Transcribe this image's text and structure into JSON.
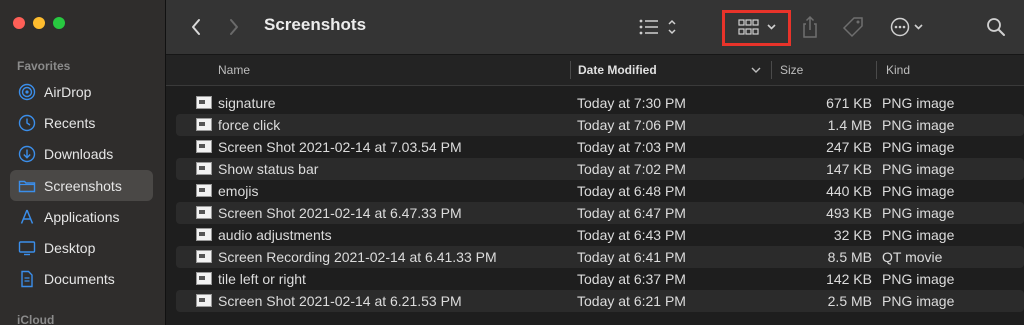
{
  "window": {
    "title": "Screenshots"
  },
  "sidebar": {
    "favorites_label": "Favorites",
    "icloud_label": "iCloud",
    "items": [
      {
        "label": "AirDrop",
        "icon": "airdrop-icon"
      },
      {
        "label": "Recents",
        "icon": "clock-icon"
      },
      {
        "label": "Downloads",
        "icon": "download-icon"
      },
      {
        "label": "Screenshots",
        "icon": "folder-icon",
        "selected": true
      },
      {
        "label": "Applications",
        "icon": "applications-icon"
      },
      {
        "label": "Desktop",
        "icon": "desktop-icon"
      },
      {
        "label": "Documents",
        "icon": "document-icon"
      }
    ]
  },
  "toolbar": {
    "back": "back-icon",
    "forward": "forward-icon",
    "view_list": "list-view-icon",
    "view_gallery": "gallery-view-icon",
    "share": "share-icon",
    "tag": "tag-icon",
    "more": "more-icon",
    "search": "search-icon"
  },
  "columns": {
    "name": "Name",
    "date": "Date Modified",
    "size": "Size",
    "kind": "Kind"
  },
  "files": [
    {
      "name": "signature",
      "date": "Today at 7:30 PM",
      "size": "671 KB",
      "kind": "PNG image"
    },
    {
      "name": "force click",
      "date": "Today at 7:06 PM",
      "size": "1.4 MB",
      "kind": "PNG image"
    },
    {
      "name": "Screen Shot 2021-02-14 at 7.03.54 PM",
      "date": "Today at 7:03 PM",
      "size": "247 KB",
      "kind": "PNG image"
    },
    {
      "name": "Show status bar",
      "date": "Today at 7:02 PM",
      "size": "147 KB",
      "kind": "PNG image"
    },
    {
      "name": "emojis",
      "date": "Today at 6:48 PM",
      "size": "440 KB",
      "kind": "PNG image"
    },
    {
      "name": "Screen Shot 2021-02-14 at 6.47.33 PM",
      "date": "Today at 6:47 PM",
      "size": "493 KB",
      "kind": "PNG image"
    },
    {
      "name": "audio adjustments",
      "date": "Today at 6:43 PM",
      "size": "32 KB",
      "kind": "PNG image"
    },
    {
      "name": "Screen Recording 2021-02-14 at 6.41.33 PM",
      "date": "Today at 6:41 PM",
      "size": "8.5 MB",
      "kind": "QT movie"
    },
    {
      "name": "tile left or right",
      "date": "Today at 6:37 PM",
      "size": "142 KB",
      "kind": "PNG image"
    },
    {
      "name": "Screen Shot 2021-02-14 at 6.21.53 PM",
      "date": "Today at 6:21 PM",
      "size": "2.5 MB",
      "kind": "PNG image"
    }
  ],
  "colors": {
    "highlight": "#e8332a",
    "sidebar_bg": "#2f2d2c",
    "accent": "#3b8eea"
  }
}
